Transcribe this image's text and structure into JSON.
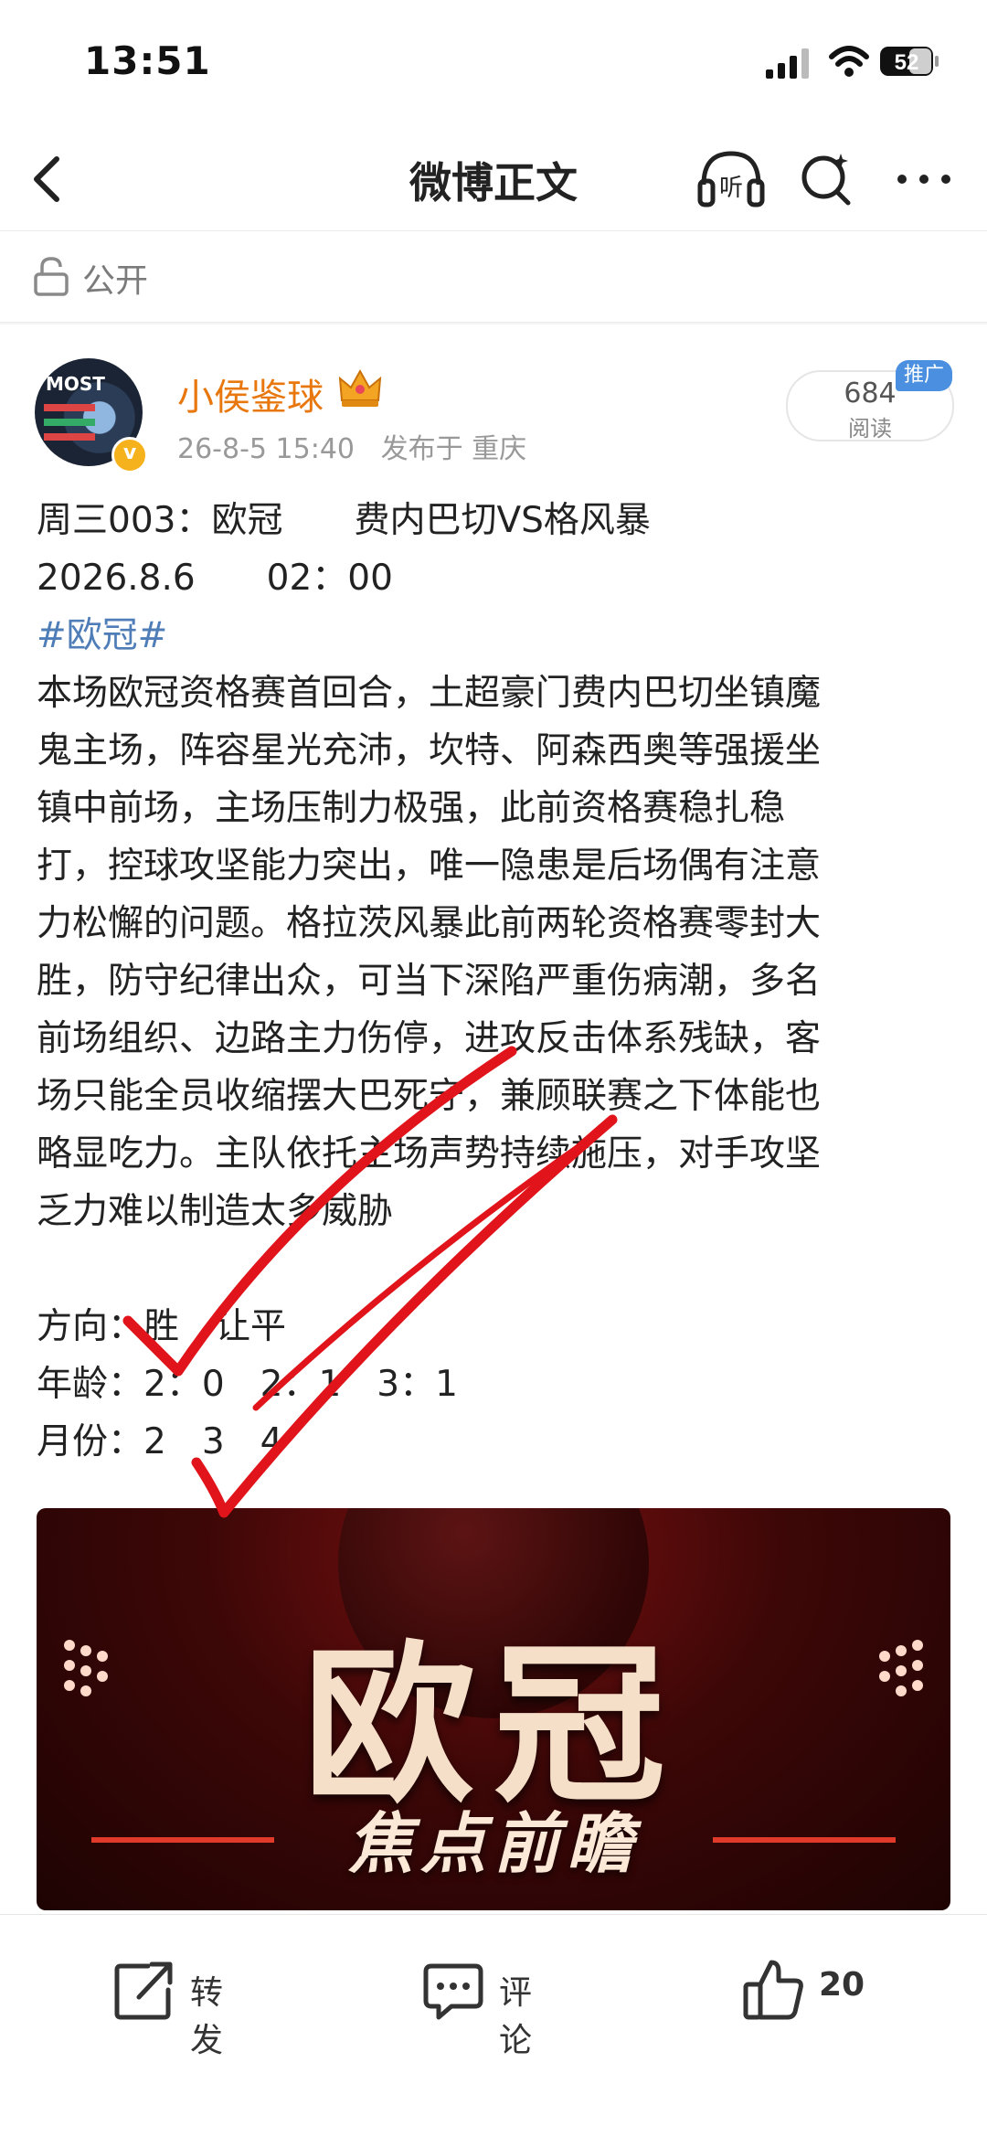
{
  "status_bar": {
    "time": "13:51",
    "battery": "52"
  },
  "nav": {
    "title": "微博正文",
    "listen_label": "听"
  },
  "visibility": {
    "label": "公开"
  },
  "author": {
    "name": "小侯鉴球",
    "time": "26-8-5 15:40",
    "location": "发布于 重庆",
    "avatar_text": "MOST"
  },
  "stats": {
    "read_count": "684",
    "read_label": "阅读",
    "promo_label": "推广"
  },
  "post": {
    "lines": [
      "周三003：欧冠　　费内巴切VS格风暴",
      "2026.8.6　　02：00"
    ],
    "hashtag": "#欧冠#",
    "paragraph": [
      "本场欧冠资格赛首回合，土超豪门费内巴切坐镇魔",
      "鬼主场，阵容星光充沛，坎特、阿森西奥等强援坐",
      "镇中前场，主场压制力极强，此前资格赛稳扎稳",
      "打，控球攻坚能力突出，唯一隐患是后场偶有注意",
      "力松懈的问题。格拉茨风暴此前两轮资格赛零封大",
      "胜，防守纪律出众，可当下深陷严重伤病潮，多名",
      "前场组织、边路主力伤停，进攻反击体系残缺，客",
      "场只能全员收缩摆大巴死守，兼顾联赛之下体能也",
      "略显吃力。主队依托主场声势持续施压，对手攻坚",
      "乏力难以制造太多威胁"
    ],
    "picks": [
      "方向：胜　让平",
      "年龄：2：0　2：1　3：1",
      "月份：2　3　4"
    ]
  },
  "banner": {
    "title": "欧冠",
    "subtitle": "焦点前瞻"
  },
  "bottom_bar": {
    "repost": "转发",
    "comment": "评论",
    "likes": "20"
  },
  "colors": {
    "username": "#e8770d",
    "hashtag": "#4f7db8",
    "promo": "#4a8fe0",
    "check": "#e0141a"
  }
}
